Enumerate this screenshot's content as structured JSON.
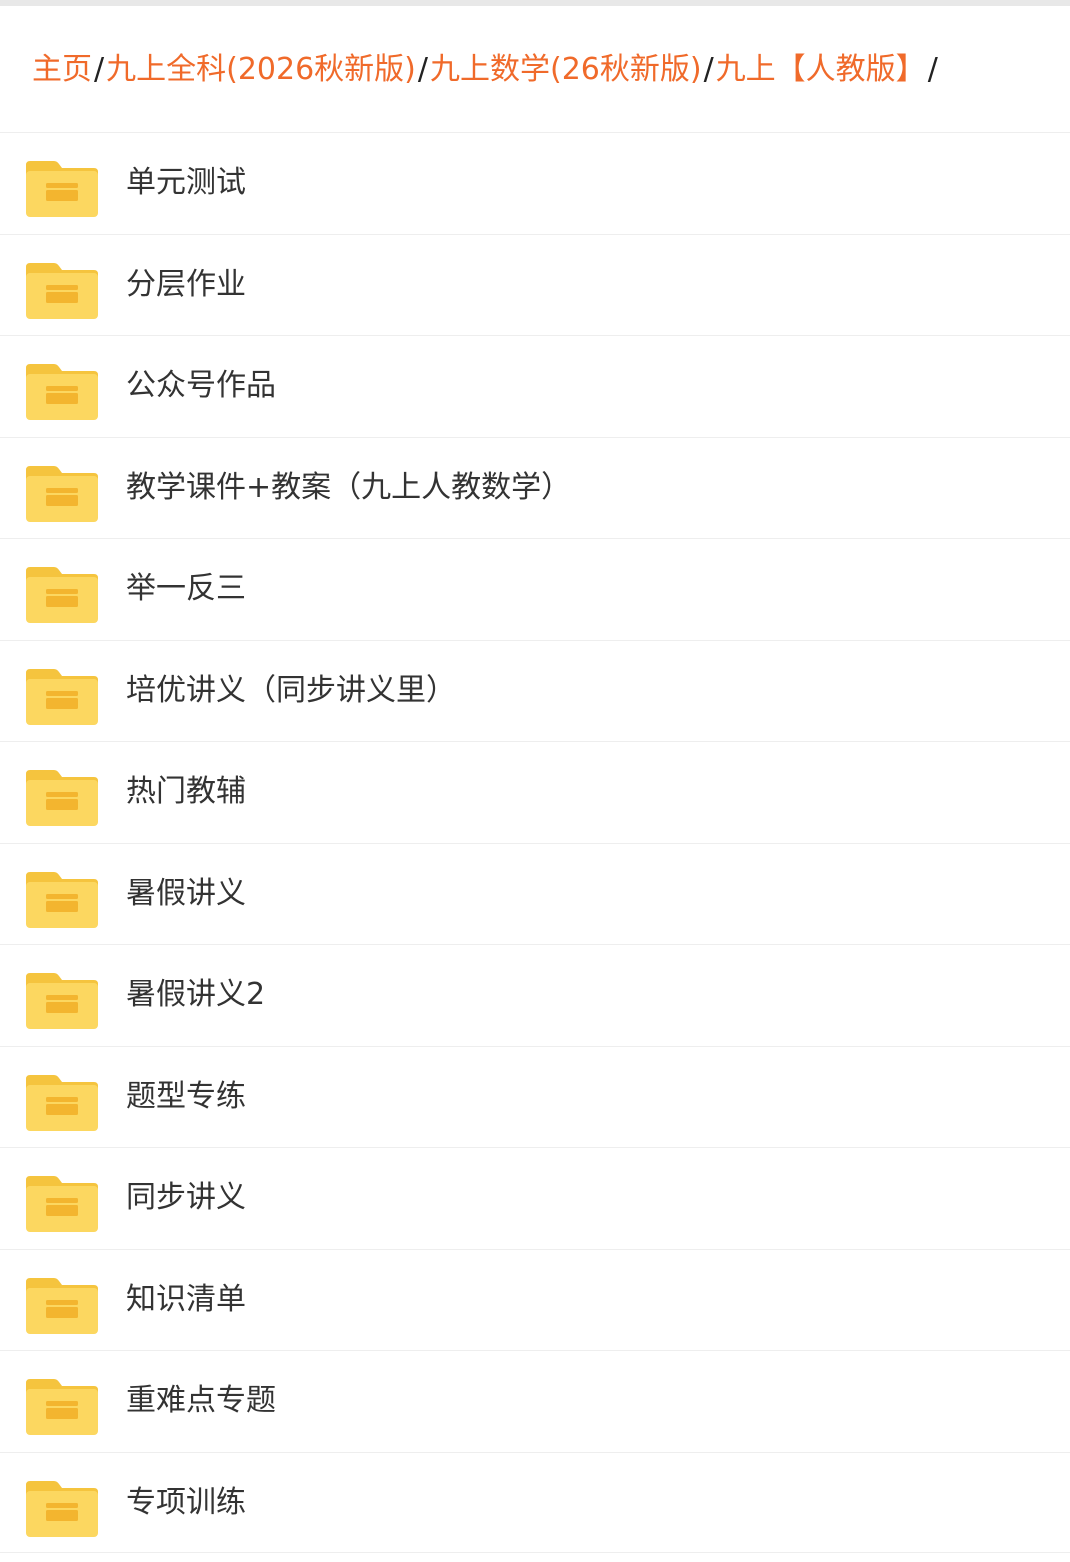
{
  "breadcrumb": {
    "items": [
      {
        "label": "主页"
      },
      {
        "label": "九上全科(2026秋新版)"
      },
      {
        "label": "九上数学(26秋新版)"
      },
      {
        "label": "九上【人教版】"
      }
    ],
    "separator": "/"
  },
  "folders": [
    {
      "name": "单元测试"
    },
    {
      "name": "分层作业"
    },
    {
      "name": "公众号作品"
    },
    {
      "name": "教学课件+教案（九上人教数学）"
    },
    {
      "name": "举一反三"
    },
    {
      "name": "培优讲义（同步讲义里）"
    },
    {
      "name": "热门教辅"
    },
    {
      "name": "暑假讲义"
    },
    {
      "name": "暑假讲义2"
    },
    {
      "name": "题型专练"
    },
    {
      "name": "同步讲义"
    },
    {
      "name": "知识清单"
    },
    {
      "name": "重难点专题"
    },
    {
      "name": "专项训练"
    }
  ],
  "icons": {
    "folder": "folder-icon"
  },
  "colors": {
    "breadcrumb_link": "#f06a2a",
    "folder_body": "#fcd760",
    "folder_tab": "#f5c43e",
    "folder_mark": "#f3b52f",
    "text": "#333333"
  }
}
